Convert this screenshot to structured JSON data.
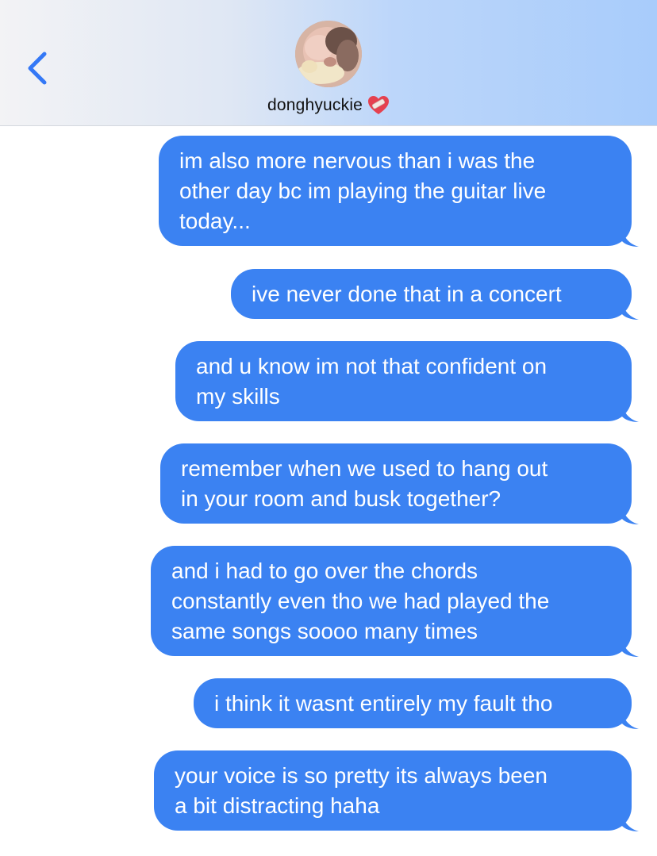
{
  "header": {
    "contact_name": "donghyuckie",
    "back_icon": "chevron-left-icon",
    "contact_emoji": "heart-with-bandage-icon",
    "accent_color": "#3478f6"
  },
  "messages": [
    {
      "text": "im also more nervous than i was the\nother day bc im playing the guitar live\ntoday...",
      "from": "me"
    },
    {
      "text": "ive never done that in a concert",
      "from": "me"
    },
    {
      "text": "and u know im not that confident on\nmy skills",
      "from": "me"
    },
    {
      "text": "remember when we used to hang out\nin your room and busk together?",
      "from": "me"
    },
    {
      "text": "and i had to go over the chords\nconstantly even tho we had played the\nsame songs soooo many times",
      "from": "me"
    },
    {
      "text": "i think it wasnt entirely my fault tho",
      "from": "me"
    },
    {
      "text": "your voice is so pretty its always been\na bit distracting haha",
      "from": "me"
    }
  ],
  "colors": {
    "bubble": "#3b82f2",
    "bubble_text": "#ffffff"
  }
}
